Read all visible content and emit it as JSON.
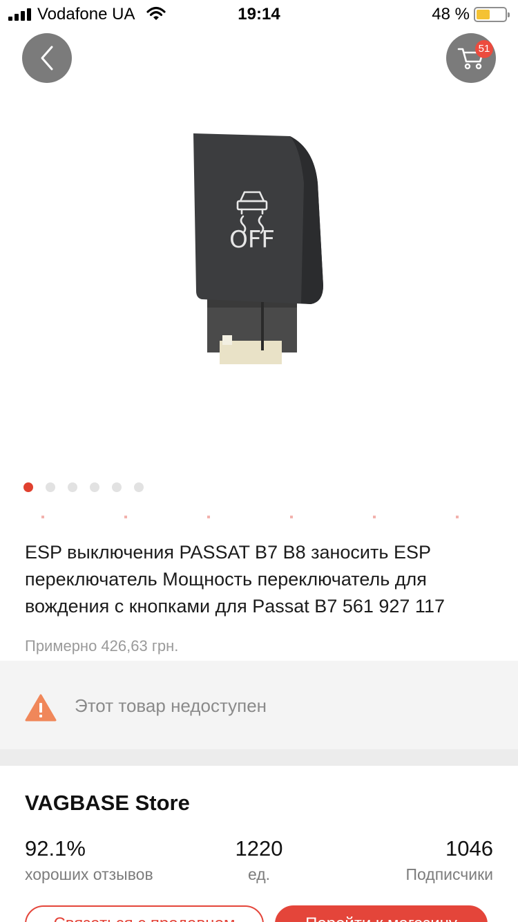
{
  "status_bar": {
    "carrier": "Vodafone UA",
    "time": "19:14",
    "battery": "48 %",
    "battery_level": 0.48,
    "battery_color": "#f4c233"
  },
  "header": {
    "back_icon": "chevron-left-icon",
    "cart_icon": "cart-icon",
    "cart_count": "51"
  },
  "gallery": {
    "image_icon": "esp-off-switch-photo",
    "image_text": "OFF",
    "dot_count": 6,
    "active_index": 0,
    "active_color": "#e0412f"
  },
  "product": {
    "title": "ESP выключения PASSAT B7 B8 заносить ESP переключатель Мощность переключатель для вождения с кнопками для Passat B7 561 927 117",
    "price": "Примерно 426,63 грн."
  },
  "availability": {
    "icon": "warning-icon",
    "text": "Этот товар недоступен",
    "icon_color": "#f0875a"
  },
  "store": {
    "name": "VAGBASE Store",
    "stats": [
      {
        "value": "92.1%",
        "label": "хороших отзывов"
      },
      {
        "value": "1220",
        "label": "ед."
      },
      {
        "value": "1046",
        "label": "Подписчики"
      }
    ],
    "contact_button": "Связаться с продавцом",
    "store_button": "Перейти к магазину",
    "accent_color": "#e4453a"
  }
}
